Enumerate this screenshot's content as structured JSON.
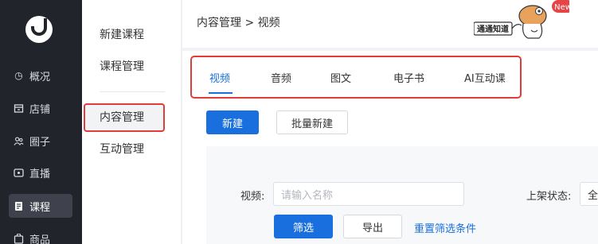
{
  "sidebar": {
    "items": [
      {
        "label": "概况",
        "icon": "clock-icon"
      },
      {
        "label": "店铺",
        "icon": "store-icon"
      },
      {
        "label": "圈子",
        "icon": "people-icon"
      },
      {
        "label": "直播",
        "icon": "live-icon"
      },
      {
        "label": "课程",
        "icon": "course-icon"
      },
      {
        "label": "商品",
        "icon": "goods-icon"
      }
    ]
  },
  "subnav": {
    "items": [
      "新建课程",
      "课程管理",
      "内容管理",
      "互动管理"
    ]
  },
  "header": {
    "breadcrumb": "内容管理 > 视频",
    "badge": "New",
    "sign": "通通知道"
  },
  "tabs": [
    "视频",
    "音频",
    "图文",
    "电子书",
    "AI互动课"
  ],
  "actions": {
    "new": "新建",
    "batch_new": "批量新建"
  },
  "filter": {
    "video_label": "视频:",
    "video_placeholder": "请输入名称",
    "status_label": "上架状态:",
    "status_value": "全",
    "filter_btn": "筛选",
    "export_btn": "导出",
    "reset_link": "重置筛选条件"
  },
  "colors": {
    "sidebar_bg": "#22242b",
    "accent": "#1a6fde",
    "highlight": "#e03c3c"
  }
}
